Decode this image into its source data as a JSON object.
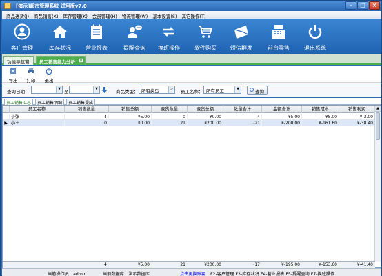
{
  "window": {
    "title": "[演示]超市管理系统 试用版v7.0"
  },
  "menu": [
    "商品进货(J)",
    "商品销售(X)",
    "库存管理(K)",
    "会员管理(H)",
    "物流管理(W)",
    "基本设置(S)",
    "其它操作(T)"
  ],
  "toolbar": [
    {
      "label": "客户管理",
      "icon": "user-circle-icon"
    },
    {
      "label": "库存状况",
      "icon": "house-icon"
    },
    {
      "label": "营业报表",
      "icon": "report-icon"
    },
    {
      "label": "提醒查询",
      "icon": "chat-person-icon"
    },
    {
      "label": "换班操作",
      "icon": "swap-arrows-icon"
    },
    {
      "label": "软件购买",
      "icon": "cart-icon"
    },
    {
      "label": "短信群发",
      "icon": "mail-icon"
    },
    {
      "label": "前台零售",
      "icon": "cash-register-icon"
    },
    {
      "label": "退出系统",
      "icon": "power-icon"
    }
  ],
  "tabs": {
    "nav": "功能导航窗口",
    "active": "员工销售能力分析"
  },
  "actions": {
    "export": "导出",
    "print": "打印",
    "exit": "退出"
  },
  "filter": {
    "date_label": "查询日期：",
    "to_label": "至",
    "type_label": "商品类型：",
    "type_value": "所有类型",
    "staff_label": "员工名称：",
    "staff_value": "所有员工",
    "query_button": "查询"
  },
  "subtabs": [
    "员工销售汇总",
    "员工销售明细",
    "员工销售提成"
  ],
  "table": {
    "headers": [
      "员工名称",
      "销售数量",
      "销售总额",
      "退货数量",
      "退货总额",
      "数量合计",
      "金额合计",
      "销售成本",
      "销售利润"
    ],
    "rows": [
      [
        "小张",
        "4",
        "¥5.00",
        "0",
        "¥0.00",
        "4",
        "¥5.00",
        "¥8.00",
        "¥-3.00"
      ],
      [
        "小王",
        "0",
        "¥0.00",
        "21",
        "¥200.00",
        "-21",
        "¥-200.00",
        "¥-161.60",
        "¥-38.40"
      ]
    ],
    "footer": [
      "",
      "4",
      "¥5.00",
      "21",
      "¥200.00",
      "-17",
      "¥-195.00",
      "¥-153.60",
      "¥-41.40"
    ]
  },
  "status": {
    "operator": "当前操作员：admin",
    "database": "当前数据库：演示数据库",
    "link": "点击更换账套",
    "shortcuts": "F2-客户管理 F3-库存状况 F4-营业报表 F5-提醒查询 F7-换班操作"
  },
  "colors": {
    "primary": "#2a6fbf",
    "tab_green": "#4caf4a",
    "highlight": "#dbe7f6"
  }
}
